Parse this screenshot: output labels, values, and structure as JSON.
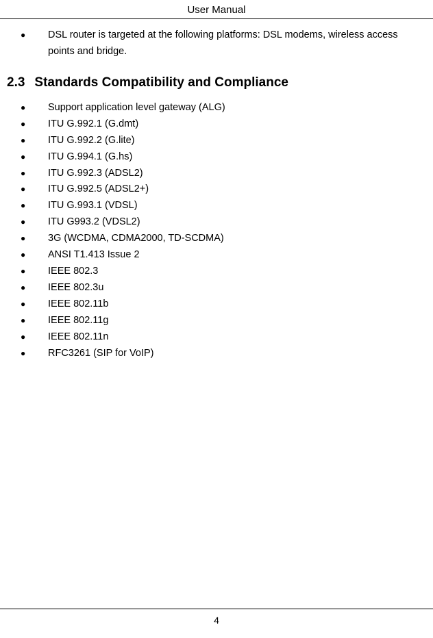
{
  "header": {
    "title": "User Manual"
  },
  "section_intro": {
    "items": [
      "DSL router is targeted at the following platforms: DSL modems, wireless access points and bridge."
    ]
  },
  "section": {
    "number": "2.3",
    "title": "Standards Compatibility and Compliance",
    "items": [
      "Support application level gateway (ALG)",
      "ITU G.992.1 (G.dmt)",
      "ITU G.992.2 (G.lite)",
      "ITU G.994.1 (G.hs)",
      "ITU G.992.3 (ADSL2)",
      "ITU G.992.5 (ADSL2+)",
      "ITU G.993.1 (VDSL)",
      "ITU G993.2 (VDSL2)",
      "3G (WCDMA, CDMA2000, TD-SCDMA)",
      "ANSI T1.413 Issue 2",
      "IEEE 802.3",
      "IEEE 802.3u",
      "IEEE 802.11b",
      "IEEE 802.11g",
      "IEEE 802.11n",
      "RFC3261 (SIP for VoIP)"
    ]
  },
  "footer": {
    "page_number": "4"
  }
}
